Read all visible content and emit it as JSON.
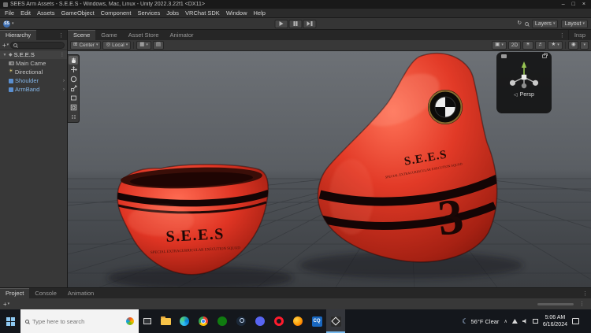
{
  "window": {
    "title": "SEES Arm Assets - S.E.E.S - Windows, Mac, Linux - Unity 2022.3.22f1 <DX11>",
    "menus": [
      "File",
      "Edit",
      "Assets",
      "GameObject",
      "Component",
      "Services",
      "Jobs",
      "VRChat SDK",
      "Window",
      "Help"
    ],
    "controls": {
      "minimize": "–",
      "maximize": "□",
      "close": "×"
    }
  },
  "toolbar": {
    "account": "SS",
    "layers": "Layers",
    "layout": "Layout"
  },
  "hierarchy": {
    "tab": "Hierarchy",
    "add": "+",
    "scene": "S.E.E.S",
    "items": [
      {
        "label": "Main Came",
        "icon": "camera"
      },
      {
        "label": "Directional",
        "icon": "directional-light"
      },
      {
        "label": "Shoulder",
        "icon": "prefab-cube"
      },
      {
        "label": "ArmBand",
        "icon": "prefab-cube"
      }
    ]
  },
  "scene_view": {
    "tabs": [
      "Scene",
      "Game",
      "Asset Store",
      "Animator"
    ],
    "inspector_stub": "Insp",
    "toolbar": {
      "pivot": "Center",
      "space": "Local",
      "mode_2d": "2D"
    },
    "gizmo": {
      "label": "Persp"
    }
  },
  "scene_objects": {
    "armband": {
      "title": "S.E.E.S",
      "subtitle": "SPECIAL EXTRACURRICULAR EXECUTION SQUAD"
    },
    "shoulder": {
      "title": "S.E.E.S",
      "subtitle": "SPECIAL EXTRACURRICULAR EXECUTION SQUAD",
      "number": "3"
    }
  },
  "bottom_panel": {
    "tabs": [
      "Project",
      "Console",
      "Animation"
    ],
    "add": "+"
  },
  "taskbar": {
    "search_placeholder": "Type here to search",
    "cq_label": "CQ",
    "apps": [
      "file-explorer",
      "edge",
      "chrome",
      "xbox",
      "steam",
      "discord",
      "opera",
      "firefox",
      "cq",
      "unity"
    ],
    "tray": {
      "weather": "56°F Clear",
      "time": "5:06 AM",
      "date": "6/16/2024"
    }
  },
  "icons": {
    "caret": "▾",
    "kebab": "⋮",
    "foldout": "▼",
    "prefab_chevron": "›",
    "sun": "☀",
    "moon": "☾",
    "scene_badge": "◆",
    "grid": "▦",
    "pivot": "⊞",
    "globe": "◎",
    "snap": "▤",
    "camera": "▣",
    "audio": "♬",
    "effects": "★",
    "eye": "◉",
    "undo": "↻",
    "gizmo_arrow": "◁",
    "hidden_chevron": "∧"
  },
  "colors": {
    "accent_red": "#d93a28",
    "prefab_blue": "#84b6e8",
    "taskbar_active": "#76b9ed"
  }
}
